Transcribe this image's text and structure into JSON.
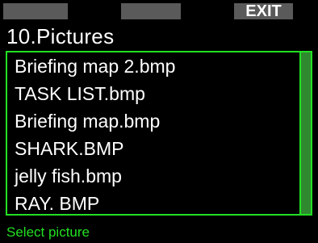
{
  "softkeys": {
    "left_label": "",
    "middle_label": "",
    "right_label": "EXIT"
  },
  "title": "10.Pictures",
  "pictures": [
    {
      "label": "Briefing map 2.bmp"
    },
    {
      "label": "TASK LIST.bmp"
    },
    {
      "label": "Briefing map.bmp"
    },
    {
      "label": "SHARK.BMP"
    },
    {
      "label": "jelly fish.bmp"
    },
    {
      "label": "RAY. BMP"
    }
  ],
  "status": "Select picture",
  "colors": {
    "accent": "#22e022",
    "softkey": "#5a5a5a",
    "background": "#000000"
  }
}
